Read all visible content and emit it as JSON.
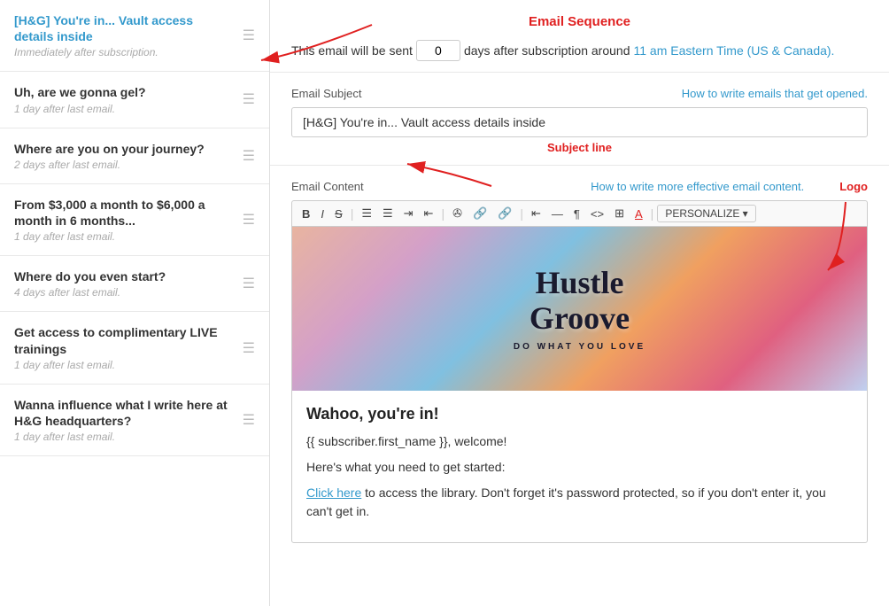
{
  "sidebar": {
    "items": [
      {
        "id": 1,
        "title": "[H&G] You're in... Vault access details inside",
        "subtitle": "Immediately after subscription.",
        "active": true,
        "titleClass": "blue"
      },
      {
        "id": 2,
        "title": "Uh, are we gonna gel?",
        "subtitle": "1 day after last email.",
        "active": false,
        "titleClass": ""
      },
      {
        "id": 3,
        "title": "Where are you on your journey?",
        "subtitle": "2 days after last email.",
        "active": false,
        "titleClass": ""
      },
      {
        "id": 4,
        "title": "From $3,000 a month to $6,000 a month in 6 months...",
        "subtitle": "1 day after last email.",
        "active": false,
        "titleClass": ""
      },
      {
        "id": 5,
        "title": "Where do you even start?",
        "subtitle": "4 days after last email.",
        "active": false,
        "titleClass": ""
      },
      {
        "id": 6,
        "title": "Get access to complimentary LIVE trainings",
        "subtitle": "1 day after last email.",
        "active": false,
        "titleClass": ""
      },
      {
        "id": 7,
        "title": "Wanna influence what I write here at H&G headquarters?",
        "subtitle": "1 day after last email.",
        "active": false,
        "titleClass": ""
      }
    ]
  },
  "main": {
    "email_sequence_label": "Email Sequence",
    "send_timing_prefix": "This email will be sent",
    "send_timing_days": "0",
    "send_timing_suffix": "days after subscription around",
    "send_timing_time": "11 am Eastern Time (US & Canada).",
    "subject_label": "Email Subject",
    "subject_link": "How to write emails that get opened.",
    "subject_value": "[H&G] You're in... Vault access details inside",
    "subject_placeholder": "",
    "subject_line_annotation": "Subject line",
    "content_label": "Email Content",
    "content_link": "How to write more effective email content.",
    "logo_annotation": "Logo",
    "toolbar": {
      "bold": "B",
      "italic": "I",
      "strikethrough": "S",
      "ul": "☰",
      "ol": "☰",
      "indent": "☰",
      "outdent": "☰",
      "image": "🖼",
      "link": "🔗",
      "unlink": "🔗",
      "align": "☰",
      "hr": "—",
      "para": "¶",
      "code": "<>",
      "table": "⊞",
      "fontcolor": "A",
      "personalize": "PERSONALIZE ▾"
    },
    "email_body": {
      "hero_logo_line1": "Hustle",
      "hero_logo_line2": "Groove",
      "hero_tagline": "DO WHAT YOU LOVE",
      "heading": "Wahoo, you're in!",
      "para1": "{{ subscriber.first_name }}, welcome!",
      "para2": "Here's what you need to get started:",
      "para3_link": "Click here",
      "para3_text": " to access the library. Don't forget it's password protected, so if you don't enter it, you can't get in."
    }
  }
}
